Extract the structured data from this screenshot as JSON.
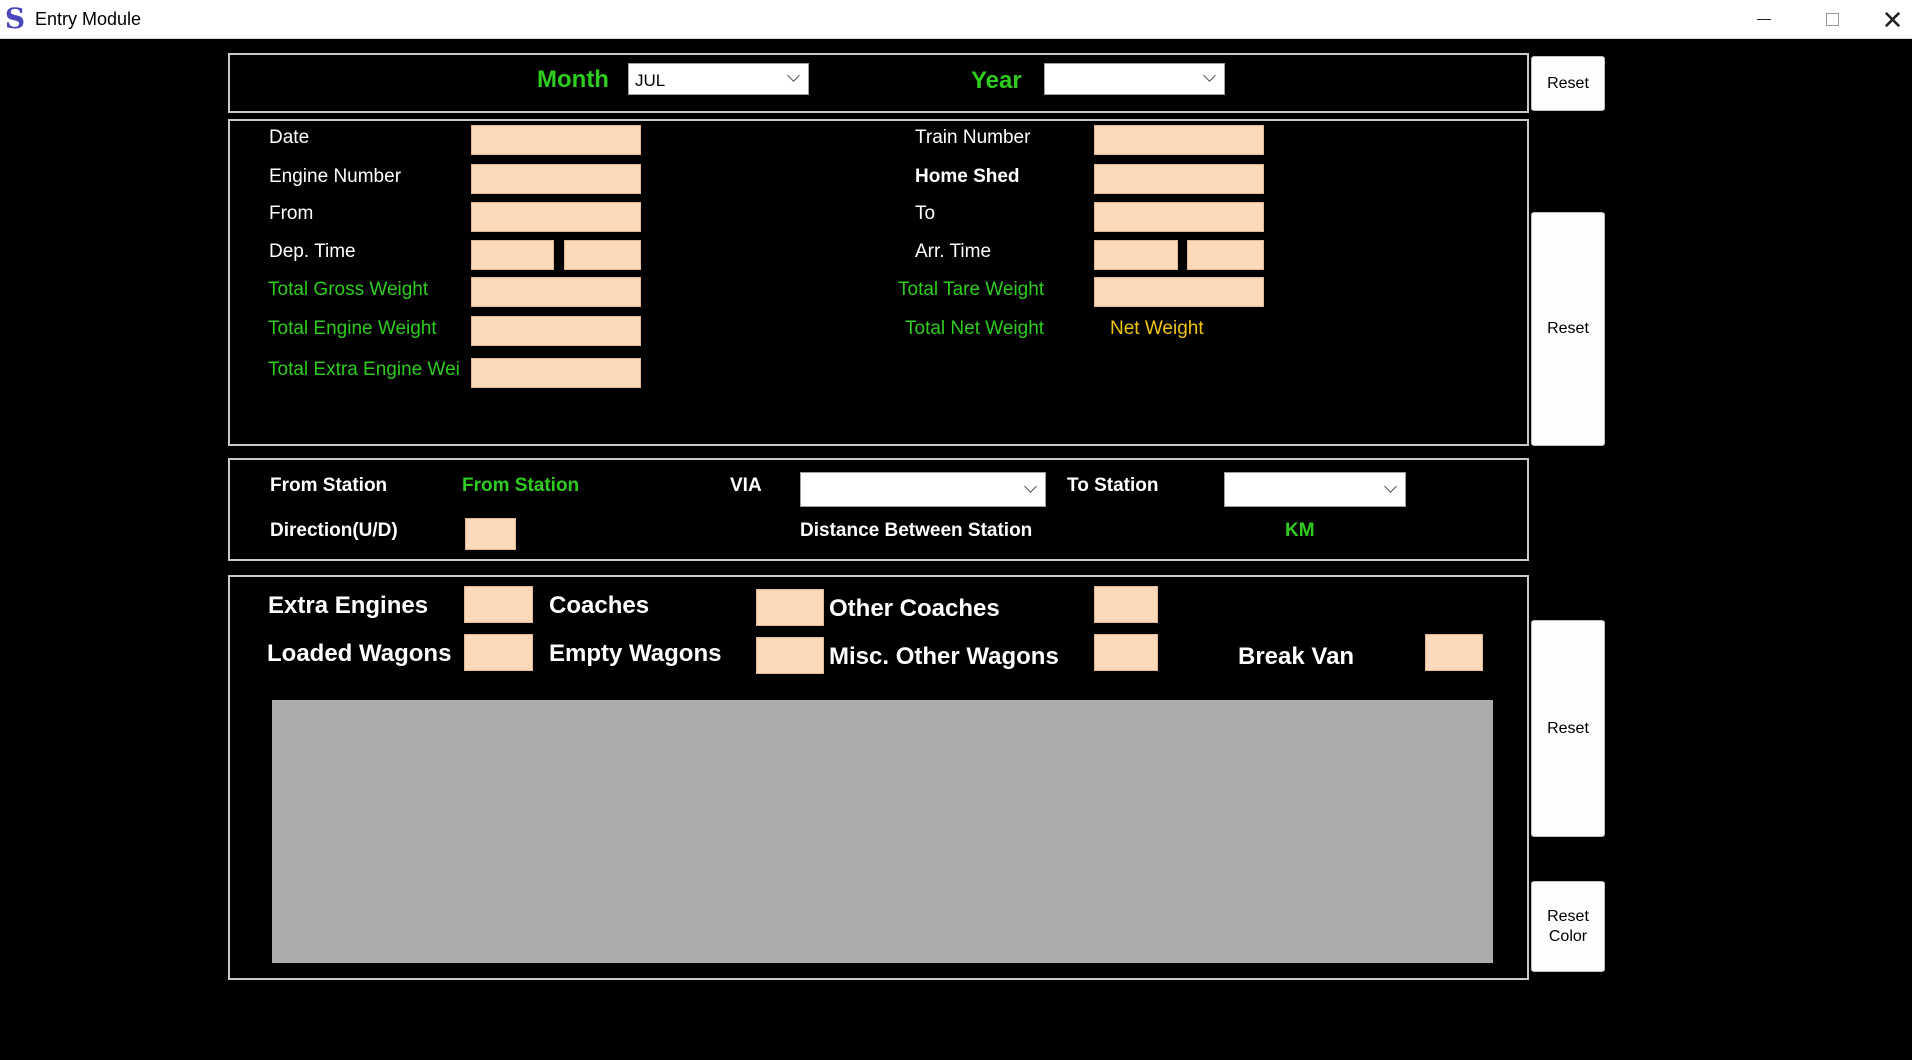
{
  "window": {
    "title": "Entry Module",
    "icon": "s-logo-icon",
    "close_glyph": "✕"
  },
  "period": {
    "month_label": "Month",
    "month_value": "JUL",
    "year_label": "Year",
    "year_value": ""
  },
  "train": {
    "date_label": "Date",
    "engine_number_label": "Engine Number",
    "from_label": "From",
    "dep_time_label": "Dep. Time",
    "total_gross_weight_label": "Total Gross Weight",
    "total_engine_weight_label": "Total Engine Weight",
    "total_extra_engine_weight_label": "Total Extra Engine Wei",
    "train_number_label": "Train Number",
    "home_shed_label": "Home Shed",
    "to_label": "To",
    "arr_time_label": "Arr. Time",
    "total_tare_weight_label": "Total Tare Weight",
    "total_net_weight_label": "Total Net Weight",
    "net_weight_value": "Net Weight"
  },
  "route": {
    "from_station_label": "From Station",
    "from_station_value": "From Station",
    "via_label": "VIA",
    "via_value": "",
    "to_station_label": "To Station",
    "to_station_value": "",
    "direction_label": "Direction(U/D)",
    "distance_label": "Distance Between Station",
    "distance_unit": "KM"
  },
  "wagons": {
    "extra_engines_label": "Extra Engines",
    "coaches_label": "Coaches",
    "other_coaches_label": "Other Coaches",
    "loaded_wagons_label": "Loaded Wagons",
    "empty_wagons_label": "Empty Wagons",
    "misc_other_wagons_label": "Misc. Other Wagons",
    "break_van_label": "Break Van"
  },
  "buttons": {
    "reset_top": "Reset",
    "reset_train": "Reset",
    "reset_wagons": "Reset",
    "reset_color": "Reset\nColor"
  },
  "colors": {
    "background": "#000000",
    "input_fill": "#fcd9b8",
    "label_green": "#2ecc1e",
    "label_yellow": "#f1c40f",
    "grid_gray": "#ababab"
  }
}
